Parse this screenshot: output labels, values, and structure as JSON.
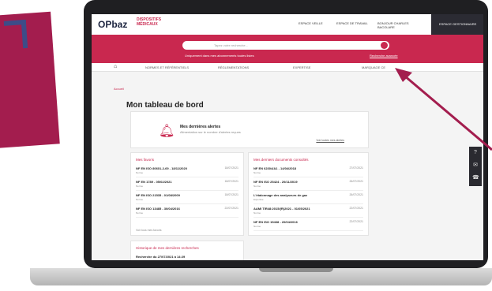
{
  "promo": {
    "text": "no"
  },
  "header": {
    "logo_main": "OPbaz",
    "logo_sub": "DISPOSITIFS MÉDICAUX",
    "links": [
      "ESPACE VEILLE",
      "ESPACE DE TRAVAIL",
      "BONJOUR CHARLES BACOLARE"
    ],
    "dark_button": "ESPACE GESTIONNAIRE"
  },
  "search": {
    "placeholder": "Tapez votre recherche...",
    "hint": "Uniquement dans mes abonnements toutes listes",
    "advanced": "Recherche avancée"
  },
  "nav": {
    "items": [
      "NORMES ET RÉFÉRENTIELS",
      "RÉGLEMENTATIONS",
      "EXPERTISE",
      "MARQUAGE CE"
    ]
  },
  "breadcrumb": "Accueil",
  "page_title": "Mon tableau de bord",
  "alerts": {
    "title": "Mes dernières alertes",
    "subtitle": "Alimentation sur le nombre d'alertes reçues",
    "link": "Voir toutes mes alertes"
  },
  "favorites": {
    "title": "Mes favoris",
    "see_all": "Voir tous mes favoris",
    "rows": [
      {
        "title": "NF EN ISO 80601-2-69 - 18/11/2020",
        "sub": "Norme",
        "date": "18/07/2021"
      },
      {
        "title": "NF EN 1789 - 05/02/2021",
        "sub": "Norme",
        "date": "18/07/2021"
      },
      {
        "title": "NF EN ISO 21535 - 01/08/2009",
        "sub": "Norme",
        "date": "18/07/2021"
      },
      {
        "title": "NF EN ISO 13485 - 30/04/2016",
        "sub": "Norme",
        "date": "22/07/2021"
      }
    ]
  },
  "documents": {
    "title": "Mes derniers documents consultés",
    "rows": [
      {
        "title": "NF EN 62304/A1 - 14/04/2018",
        "sub": "Norme",
        "date": "27/07/2021"
      },
      {
        "title": "NF EN ISO 25424 - 20/11/2019",
        "sub": "Norme",
        "date": "26/07/2021"
      },
      {
        "title": "L'étalonnage des analyseurs de gaz",
        "sub": "Expertise",
        "date": "26/07/2021"
      },
      {
        "title": "AAMI TIR48:2015/(R)2021 - 01/05/2021",
        "sub": "Norme",
        "date": "22/07/2021"
      },
      {
        "title": "NF EN ISO 15438 - 20/04/2016",
        "sub": "Norme",
        "date": "22/07/2021"
      }
    ]
  },
  "history": {
    "title": "Historique de mes dernières recherches",
    "first_row": "Recherche du 27/07/2021 à 14:29"
  },
  "colors": {
    "brand": "#c9284f",
    "dark": "#2b2b33",
    "promo": "#a31d4e",
    "accent": "#3d4c88"
  }
}
